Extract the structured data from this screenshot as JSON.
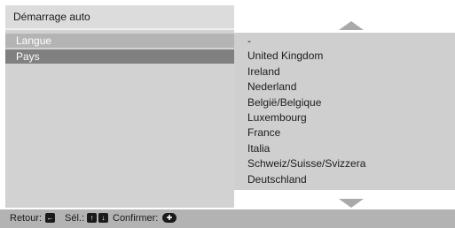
{
  "header": {
    "title": "Démarrage auto"
  },
  "menu": {
    "items": [
      {
        "label": "Langue"
      },
      {
        "label": "Pays"
      }
    ]
  },
  "country_list": {
    "items": [
      "-",
      "United Kingdom",
      "Ireland",
      "Nederland",
      "België/Belgique",
      "Luxembourg",
      "France",
      "Italia",
      "Schweiz/Suisse/Svizzera",
      "Deutschland"
    ]
  },
  "footer": {
    "retour_label": "Retour:",
    "sel_label": "Sél.:",
    "confirmer_label": "Confirmer:"
  }
}
